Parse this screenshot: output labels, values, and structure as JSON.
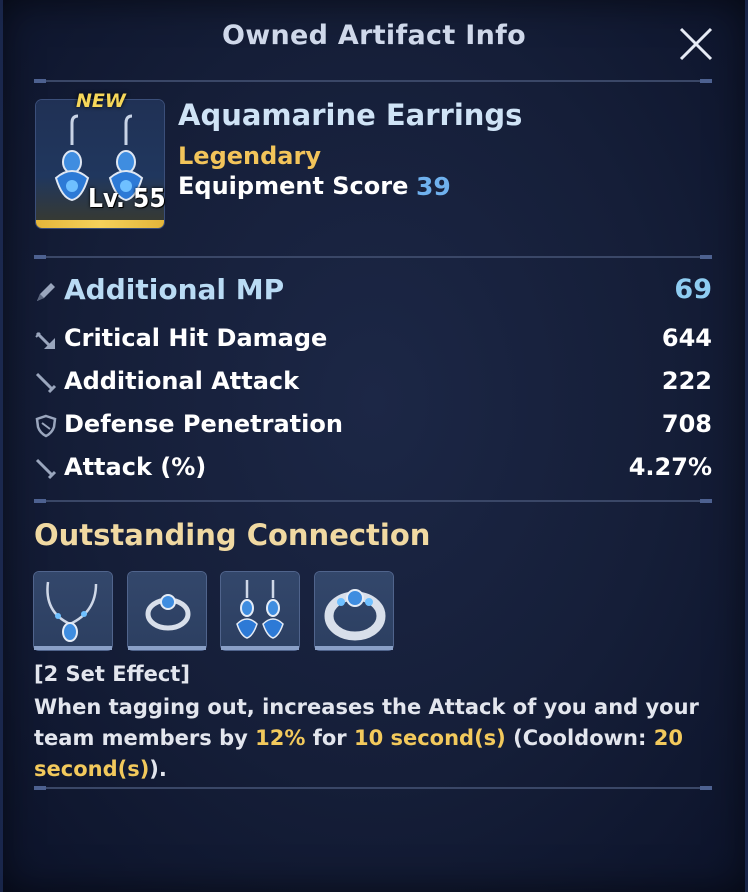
{
  "window": {
    "title": "Owned Artifact Info",
    "close_icon": "close-icon"
  },
  "item": {
    "badge_new": "NEW",
    "level": "Lv. 55",
    "name": "Aquamarine Earrings",
    "rarity": "Legendary",
    "score_label": "Equipment Score",
    "score_value": "39",
    "icon": "earrings-icon",
    "rarity_color": "#f2c45a"
  },
  "stats": [
    {
      "icon": "pen-icon",
      "label": "Additional MP",
      "value": "69"
    },
    {
      "icon": "arrow-down-right-icon",
      "label": "Critical Hit Damage",
      "value": "644"
    },
    {
      "icon": "sword-icon",
      "label": "Additional Attack",
      "value": "222"
    },
    {
      "icon": "shield-icon",
      "label": "Defense Penetration",
      "value": "708"
    },
    {
      "icon": "sword-icon",
      "label": "Attack (%)",
      "value": "4.27%"
    }
  ],
  "set": {
    "title": "Outstanding Connection",
    "pieces": [
      {
        "icon": "necklace-icon"
      },
      {
        "icon": "ring-icon"
      },
      {
        "icon": "earrings-icon"
      },
      {
        "icon": "bracelet-icon"
      }
    ],
    "effect_head": "[2 Set Effect]",
    "desc_1": "When tagging out, increases the Attack of you and your team members by ",
    "desc_pct": "12%",
    "desc_2": " for ",
    "desc_dur": "10 second(s)",
    "desc_3": " (Cooldown: ",
    "desc_cd": "20 second(s)",
    "desc_4": ")."
  },
  "colors": {
    "highlight": "#f2c95c",
    "score": "#6fb1ee",
    "set_title": "#f0d9a2"
  }
}
